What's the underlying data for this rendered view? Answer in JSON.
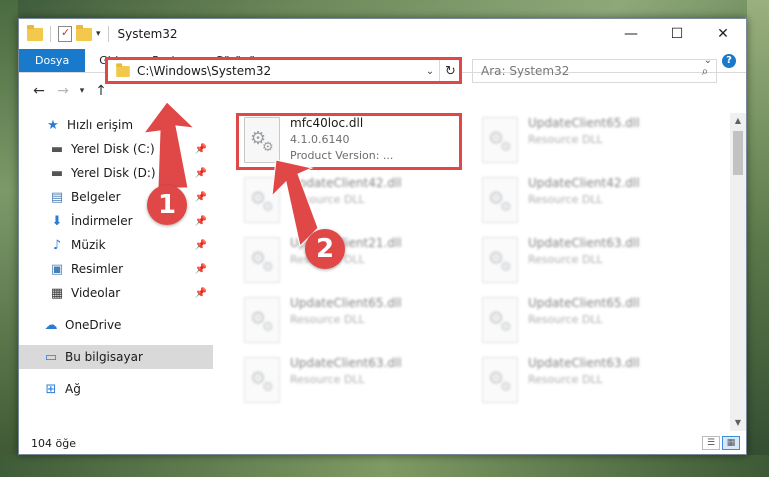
{
  "window": {
    "title": "System32",
    "controls": {
      "minimize": "—",
      "maximize": "☐",
      "close": "✕"
    }
  },
  "ribbon": {
    "tabs": [
      "Dosya",
      "Giriş",
      "Paylaş",
      "Görünüm"
    ],
    "active_tab": "Dosya",
    "accent_color": "#1979ca"
  },
  "navigation": {
    "back_icon": "arrow-left",
    "forward_icon": "arrow-right",
    "recent_icon": "chevron-down",
    "up_icon": "arrow-up",
    "address": "C:\\Windows\\System32",
    "search_placeholder": "Ara: System32"
  },
  "sidebar": {
    "items": [
      {
        "label": "Hızlı erişim",
        "icon": "star-icon",
        "pinned": false
      },
      {
        "label": "Yerel Disk (C:)",
        "icon": "drive-icon",
        "pinned": true
      },
      {
        "label": "Yerel Disk (D:)",
        "icon": "drive-icon",
        "pinned": true
      },
      {
        "label": "Belgeler",
        "icon": "documents-icon",
        "pinned": true
      },
      {
        "label": "İndirmeler",
        "icon": "download-icon",
        "pinned": true
      },
      {
        "label": "Müzik",
        "icon": "music-icon",
        "pinned": true
      },
      {
        "label": "Resimler",
        "icon": "pictures-icon",
        "pinned": true
      },
      {
        "label": "Videolar",
        "icon": "videos-icon",
        "pinned": true
      },
      {
        "label": "OneDrive",
        "icon": "cloud-icon",
        "pinned": false
      },
      {
        "label": "Bu bilgisayar",
        "icon": "computer-icon",
        "pinned": false,
        "selected": true
      },
      {
        "label": "Ağ",
        "icon": "network-icon",
        "pinned": false
      }
    ]
  },
  "files": [
    {
      "name": "mfc40loc.dll",
      "line2": "4.1.0.6140",
      "line3": "Product Version:   ..."
    },
    {
      "name": "UpdateClient65.dll",
      "line2": "Resource DLL"
    },
    {
      "name": "UpdateClient42.dll",
      "line2": "Resource DLL"
    },
    {
      "name": "UpdateClient42.dll",
      "line2": "Resource DLL"
    },
    {
      "name": "UpdateClient21.dll",
      "line2": "Resource DLL"
    },
    {
      "name": "UpdateClient63.dll",
      "line2": "Resource DLL"
    },
    {
      "name": "UpdateClient65.dll",
      "line2": "Resource DLL"
    },
    {
      "name": "UpdateClient65.dll",
      "line2": "Resource DLL"
    },
    {
      "name": "UpdateClient63.dll",
      "line2": "Resource DLL"
    },
    {
      "name": "UpdateClient63.dll",
      "line2": "Resource DLL"
    }
  ],
  "status": {
    "item_count": "104 öğe"
  },
  "annotations": {
    "step1": "1",
    "step2": "2",
    "highlight_color": "#e04848"
  }
}
